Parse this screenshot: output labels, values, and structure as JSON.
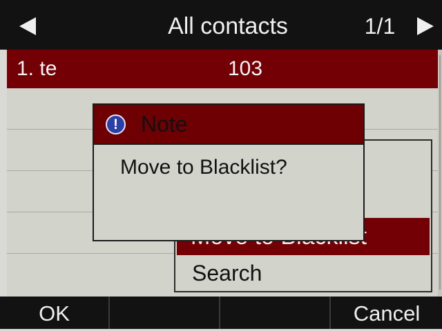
{
  "header": {
    "title": "All contacts",
    "page": "1/1",
    "prev_icon": "left-triangle-icon",
    "next_icon": "right-triangle-icon"
  },
  "contacts": [
    {
      "label": "1. te",
      "number": "103"
    }
  ],
  "menu": {
    "items": [
      {
        "label": "Move to Blacklist",
        "selected": true
      },
      {
        "label": "Search",
        "selected": false
      }
    ]
  },
  "dialog": {
    "title": "Note",
    "icon": "info-icon",
    "message": "Move to Blacklist?"
  },
  "softkeys": [
    "OK",
    "",
    "",
    "Cancel"
  ],
  "colors": {
    "accent": "#720005",
    "bar": "#121212",
    "background": "#d2d4cc",
    "icon": "#2a3fa8"
  }
}
